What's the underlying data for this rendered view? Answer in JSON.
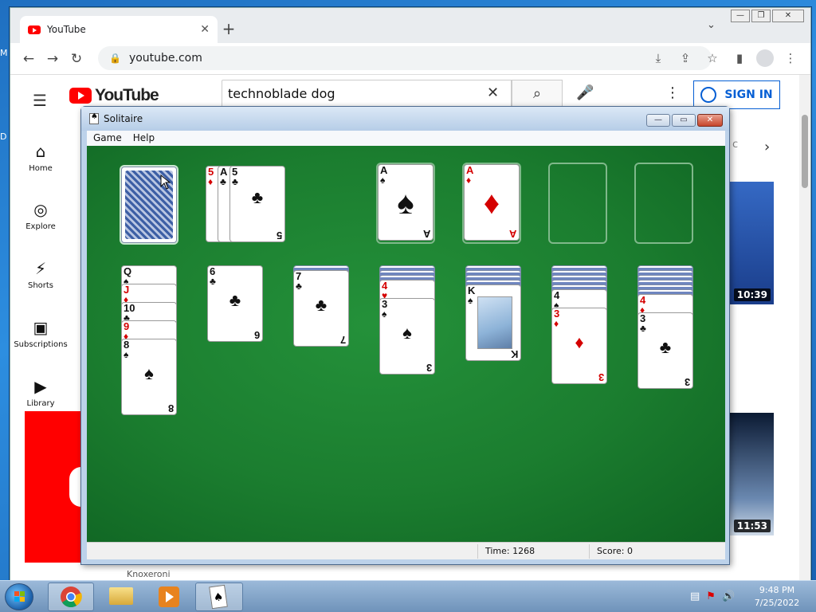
{
  "desktop": {
    "edge_m": "M",
    "edge_d": "D"
  },
  "chrome": {
    "tab_title": "YouTube",
    "tab_close": "✕",
    "new_tab": "+",
    "tab_list": "⌄",
    "window_min": "—",
    "window_max": "❐",
    "window_close": "✕",
    "url": "youtube.com",
    "back": "←",
    "forward": "→",
    "reload": "↻",
    "lock": "🔒",
    "tb_install": "⤓",
    "tb_share": "⇪",
    "tb_star": "☆",
    "tb_sidepanel": "▮",
    "tb_menu": "⋮"
  },
  "youtube": {
    "logo": "YouTube",
    "search_value": "technoblade dog",
    "search_clear": "✕",
    "search_icon": "⌕",
    "mic": "🎤",
    "more": "⋮",
    "sign_in": "SIGN IN",
    "nav": [
      {
        "label": "Home",
        "icon": "⌂"
      },
      {
        "label": "Explore",
        "icon": "◎"
      },
      {
        "label": "Shorts",
        "icon": "⚡"
      },
      {
        "label": "Subscriptions",
        "icon": "▣"
      },
      {
        "label": "Library",
        "icon": "▶"
      }
    ],
    "chip_fragment": "c",
    "chip_next": "›",
    "durations": [
      "10:39",
      "11:53"
    ],
    "bottom_channel": "Knoxeroni"
  },
  "solitaire": {
    "title": "Solitaire",
    "btn_min": "—",
    "btn_max": "▭",
    "btn_close": "✕",
    "menu": [
      "Game",
      "Help"
    ],
    "time_label": "Time: 1268",
    "score_label": "Score: 0",
    "waste": [
      {
        "rank": "5",
        "suit": "♦",
        "color": "red"
      },
      {
        "rank": "A",
        "suit": "♣",
        "color": "blk"
      },
      {
        "rank": "5",
        "suit": "♣",
        "color": "blk"
      }
    ],
    "foundations": [
      {
        "rank": "A",
        "suit": "♠",
        "color": "blk"
      },
      {
        "rank": "A",
        "suit": "♦",
        "color": "red"
      }
    ],
    "tableau": [
      {
        "hidden": 0,
        "cards": [
          {
            "rank": "Q",
            "suit": "♠",
            "color": "blk"
          },
          {
            "rank": "J",
            "suit": "♦",
            "color": "red"
          },
          {
            "rank": "10",
            "suit": "♣",
            "color": "blk"
          },
          {
            "rank": "9",
            "suit": "♦",
            "color": "red"
          },
          {
            "rank": "8",
            "suit": "♠",
            "color": "blk"
          }
        ]
      },
      {
        "hidden": 0,
        "cards": [
          {
            "rank": "6",
            "suit": "♣",
            "color": "blk"
          }
        ]
      },
      {
        "hidden": 1,
        "cards": [
          {
            "rank": "7",
            "suit": "♣",
            "color": "blk"
          }
        ]
      },
      {
        "hidden": 3,
        "cards": [
          {
            "rank": "4",
            "suit": "♥",
            "color": "red"
          },
          {
            "rank": "3",
            "suit": "♠",
            "color": "blk"
          }
        ]
      },
      {
        "hidden": 4,
        "cards": [
          {
            "rank": "K",
            "suit": "♠",
            "color": "blk"
          }
        ]
      },
      {
        "hidden": 5,
        "cards": [
          {
            "rank": "4",
            "suit": "♠",
            "color": "blk"
          },
          {
            "rank": "3",
            "suit": "♦",
            "color": "red"
          }
        ]
      },
      {
        "hidden": 6,
        "cards": [
          {
            "rank": "4",
            "suit": "♦",
            "color": "red"
          },
          {
            "rank": "3",
            "suit": "♣",
            "color": "blk"
          }
        ]
      }
    ]
  },
  "taskbar": {
    "time": "9:48 PM",
    "date": "7/25/2022"
  }
}
